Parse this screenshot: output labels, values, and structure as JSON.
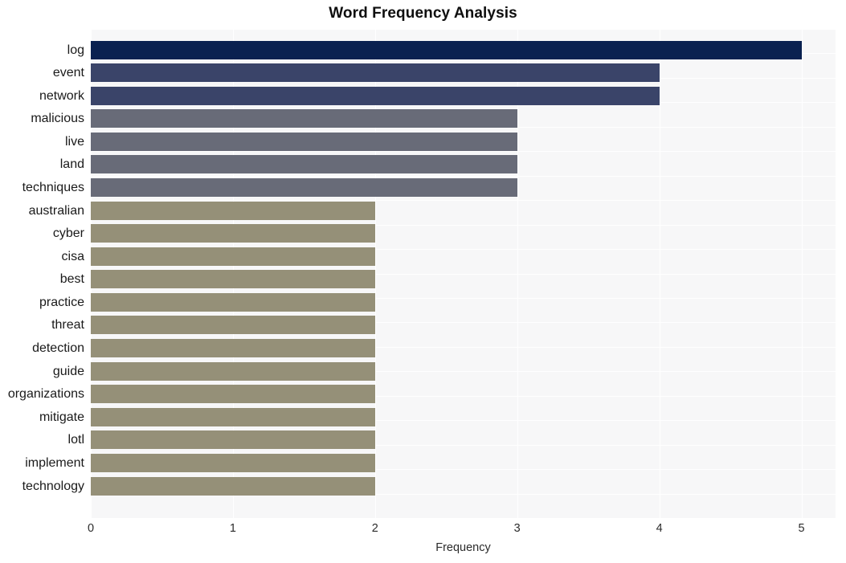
{
  "chart_data": {
    "type": "bar",
    "orientation": "horizontal",
    "title": "Word Frequency Analysis",
    "xlabel": "Frequency",
    "ylabel": "",
    "xlim": [
      0,
      5.24
    ],
    "xticks": [
      0,
      1,
      2,
      3,
      4,
      5
    ],
    "xtick_labels": [
      "0",
      "1",
      "2",
      "3",
      "4",
      "5"
    ],
    "grid": "white gridlines on light gray panel",
    "legend": "none",
    "categories": [
      "log",
      "event",
      "network",
      "malicious",
      "live",
      "land",
      "techniques",
      "australian",
      "cyber",
      "cisa",
      "best",
      "practice",
      "threat",
      "detection",
      "guide",
      "organizations",
      "mitigate",
      "lotl",
      "implement",
      "technology"
    ],
    "values": [
      5,
      4,
      4,
      3,
      3,
      3,
      3,
      2,
      2,
      2,
      2,
      2,
      2,
      2,
      2,
      2,
      2,
      2,
      2,
      2
    ],
    "bar_colors": [
      "#0a2150",
      "#3a4469",
      "#3a4469",
      "#686b78",
      "#686b78",
      "#686b78",
      "#686b78",
      "#959078",
      "#959078",
      "#959078",
      "#959078",
      "#959078",
      "#959078",
      "#959078",
      "#959078",
      "#959078",
      "#959078",
      "#959078",
      "#959078",
      "#959078"
    ]
  },
  "palette": {
    "bar_darkest": "#0a2150",
    "bar_navy": "#3a4469",
    "bar_gray": "#686b78",
    "bar_khaki": "#959078",
    "panel_background": "#f7f7f8",
    "gridline": "#ffffff",
    "figure_background": "#ffffff",
    "text": "#2b2b2b",
    "title_text": "#0f0f0f"
  }
}
